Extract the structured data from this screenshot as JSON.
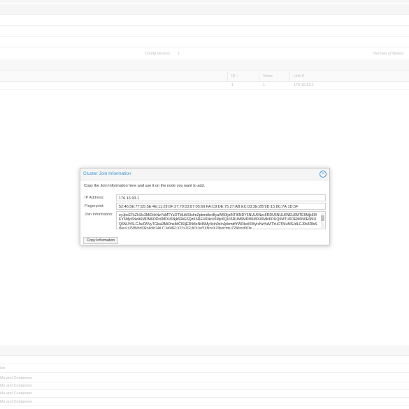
{
  "background": {
    "config": {
      "version_label": "Config Version",
      "version_value": "1",
      "nodes_label": "Number of Nodes"
    },
    "node_table": {
      "columns": [
        "ID",
        "Votes",
        "Link 0"
      ],
      "row": {
        "id": "1",
        "votes": "1",
        "link0": "176.16.93.1"
      }
    },
    "bottom_rows": [
      "ion",
      "Ms and Containers",
      "Ms and Containers",
      "Ms and Containers",
      "Ms and Containers"
    ]
  },
  "dialog": {
    "title": "Cluster Join Information",
    "instruction": "Copy the Join Information here and use it on the node you want to add.",
    "ip_label": "IP Address:",
    "ip_value": "176.16.93.1",
    "fingerprint_label": "Fingerprint:",
    "fingerprint_value": "52:46:5E:77:D5:5E:4E:11:29:0F:27:70:03:87:05:69:FA:C9:DE:75:27:AB:EC:03:3E:2B:9D:15:8C:7A:1D:5F",
    "join_label": "Join Information:",
    "join_value": "eyJpcEFkZHJlc3MiOiIxNzYuMTYuOTMuMSIsImZpbmdlcnByaW50IjoiNTI6NDY6NUU6Nzc6RDU6NUU6NEU6MTE6Mjk6MEY6Mjc6NzA6MDM6ODc6MDU6Njk6RkE6QzK6REU6NzU6Mjc6QUI6RUM6MDM6M0U6MkI6OUQ6MTU6OEM6N0E6MUQ6NUY6LCJwZWVyTGlua3MiOnsiMCI6IjE3Ni4xNi45My4xIn0sInJpbmdfYWRkciI6WyIxNzYuMTYuOTMuMSJdLCJ0b3RlbSI6eyJzZWNhdXRoIjoib24iLCJjeWF1X21vZGUiOiJwYXNzaXZlIiwicmluZ2lkIjoxfX0=",
    "copy_label": "Copy Information"
  },
  "colors": {
    "accent": "#3892d4"
  },
  "icons": {
    "close": "close-circle-icon",
    "sort": "sort-arrow-icon"
  }
}
